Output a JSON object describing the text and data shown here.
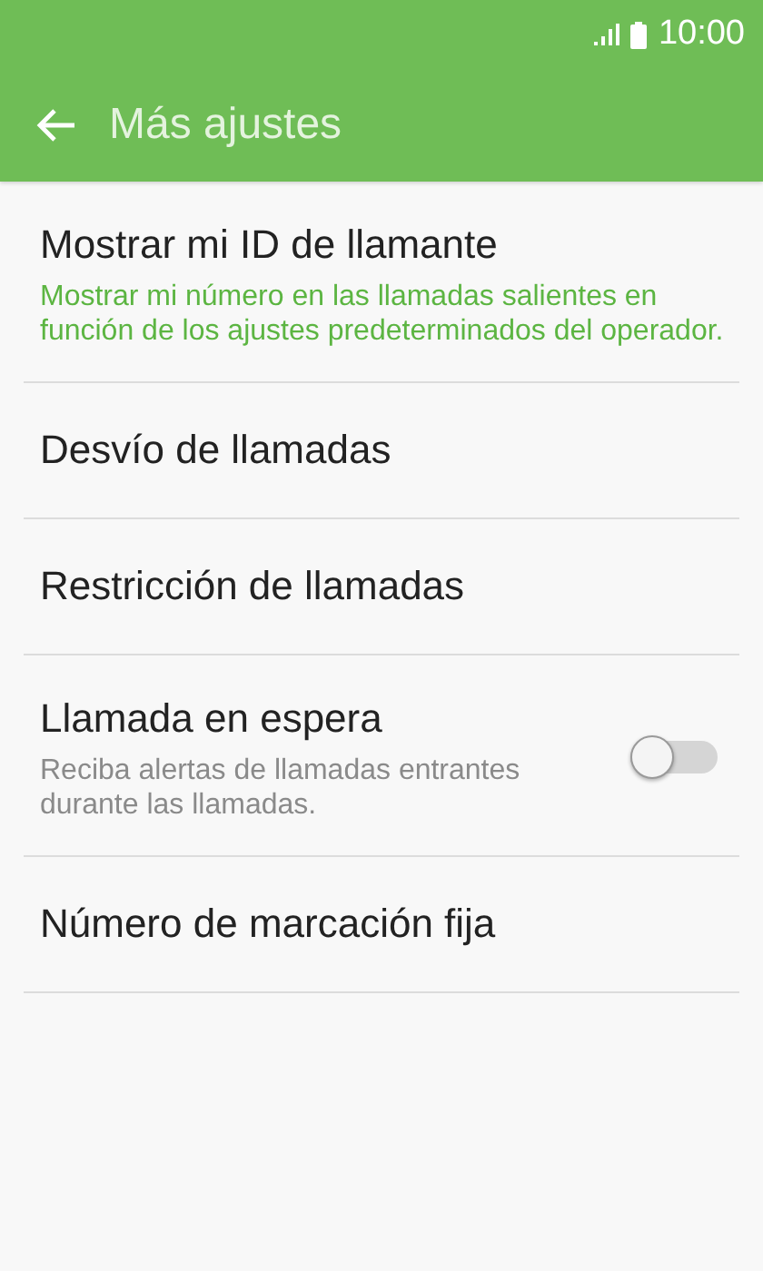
{
  "status_bar": {
    "time": "10:00"
  },
  "app_bar": {
    "title": "Más ajustes"
  },
  "items": [
    {
      "title": "Mostrar mi ID de llamante",
      "summary": "Mostrar mi número en las llamadas salientes en función de los ajustes predeterminados del operador.",
      "summary_accent": true
    },
    {
      "title": "Desvío de llamadas"
    },
    {
      "title": "Restricción de llamadas"
    },
    {
      "title": "Llamada en espera",
      "summary": "Reciba alertas de llamadas entrantes durante las llamadas.",
      "summary_accent": false,
      "switch": {
        "on": false
      }
    },
    {
      "title": "Número de marcación fija"
    }
  ]
}
